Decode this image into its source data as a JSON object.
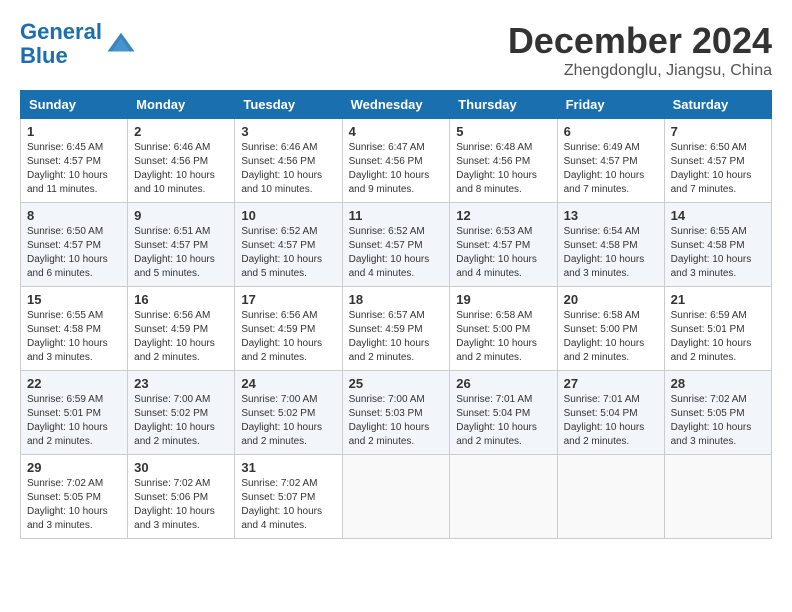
{
  "logo": {
    "line1": "General",
    "line2": "Blue"
  },
  "title": "December 2024",
  "location": "Zhengdonglu, Jiangsu, China",
  "weekdays": [
    "Sunday",
    "Monday",
    "Tuesday",
    "Wednesday",
    "Thursday",
    "Friday",
    "Saturday"
  ],
  "weeks": [
    [
      {
        "day": "1",
        "rise": "6:45 AM",
        "set": "4:57 PM",
        "daylight": "10 hours and 11 minutes."
      },
      {
        "day": "2",
        "rise": "6:46 AM",
        "set": "4:56 PM",
        "daylight": "10 hours and 10 minutes."
      },
      {
        "day": "3",
        "rise": "6:46 AM",
        "set": "4:56 PM",
        "daylight": "10 hours and 10 minutes."
      },
      {
        "day": "4",
        "rise": "6:47 AM",
        "set": "4:56 PM",
        "daylight": "10 hours and 9 minutes."
      },
      {
        "day": "5",
        "rise": "6:48 AM",
        "set": "4:56 PM",
        "daylight": "10 hours and 8 minutes."
      },
      {
        "day": "6",
        "rise": "6:49 AM",
        "set": "4:57 PM",
        "daylight": "10 hours and 7 minutes."
      },
      {
        "day": "7",
        "rise": "6:50 AM",
        "set": "4:57 PM",
        "daylight": "10 hours and 7 minutes."
      }
    ],
    [
      {
        "day": "8",
        "rise": "6:50 AM",
        "set": "4:57 PM",
        "daylight": "10 hours and 6 minutes."
      },
      {
        "day": "9",
        "rise": "6:51 AM",
        "set": "4:57 PM",
        "daylight": "10 hours and 5 minutes."
      },
      {
        "day": "10",
        "rise": "6:52 AM",
        "set": "4:57 PM",
        "daylight": "10 hours and 5 minutes."
      },
      {
        "day": "11",
        "rise": "6:52 AM",
        "set": "4:57 PM",
        "daylight": "10 hours and 4 minutes."
      },
      {
        "day": "12",
        "rise": "6:53 AM",
        "set": "4:57 PM",
        "daylight": "10 hours and 4 minutes."
      },
      {
        "day": "13",
        "rise": "6:54 AM",
        "set": "4:58 PM",
        "daylight": "10 hours and 3 minutes."
      },
      {
        "day": "14",
        "rise": "6:55 AM",
        "set": "4:58 PM",
        "daylight": "10 hours and 3 minutes."
      }
    ],
    [
      {
        "day": "15",
        "rise": "6:55 AM",
        "set": "4:58 PM",
        "daylight": "10 hours and 3 minutes."
      },
      {
        "day": "16",
        "rise": "6:56 AM",
        "set": "4:59 PM",
        "daylight": "10 hours and 2 minutes."
      },
      {
        "day": "17",
        "rise": "6:56 AM",
        "set": "4:59 PM",
        "daylight": "10 hours and 2 minutes."
      },
      {
        "day": "18",
        "rise": "6:57 AM",
        "set": "4:59 PM",
        "daylight": "10 hours and 2 minutes."
      },
      {
        "day": "19",
        "rise": "6:58 AM",
        "set": "5:00 PM",
        "daylight": "10 hours and 2 minutes."
      },
      {
        "day": "20",
        "rise": "6:58 AM",
        "set": "5:00 PM",
        "daylight": "10 hours and 2 minutes."
      },
      {
        "day": "21",
        "rise": "6:59 AM",
        "set": "5:01 PM",
        "daylight": "10 hours and 2 minutes."
      }
    ],
    [
      {
        "day": "22",
        "rise": "6:59 AM",
        "set": "5:01 PM",
        "daylight": "10 hours and 2 minutes."
      },
      {
        "day": "23",
        "rise": "7:00 AM",
        "set": "5:02 PM",
        "daylight": "10 hours and 2 minutes."
      },
      {
        "day": "24",
        "rise": "7:00 AM",
        "set": "5:02 PM",
        "daylight": "10 hours and 2 minutes."
      },
      {
        "day": "25",
        "rise": "7:00 AM",
        "set": "5:03 PM",
        "daylight": "10 hours and 2 minutes."
      },
      {
        "day": "26",
        "rise": "7:01 AM",
        "set": "5:04 PM",
        "daylight": "10 hours and 2 minutes."
      },
      {
        "day": "27",
        "rise": "7:01 AM",
        "set": "5:04 PM",
        "daylight": "10 hours and 2 minutes."
      },
      {
        "day": "28",
        "rise": "7:02 AM",
        "set": "5:05 PM",
        "daylight": "10 hours and 3 minutes."
      }
    ],
    [
      {
        "day": "29",
        "rise": "7:02 AM",
        "set": "5:05 PM",
        "daylight": "10 hours and 3 minutes."
      },
      {
        "day": "30",
        "rise": "7:02 AM",
        "set": "5:06 PM",
        "daylight": "10 hours and 3 minutes."
      },
      {
        "day": "31",
        "rise": "7:02 AM",
        "set": "5:07 PM",
        "daylight": "10 hours and 4 minutes."
      },
      null,
      null,
      null,
      null
    ]
  ]
}
